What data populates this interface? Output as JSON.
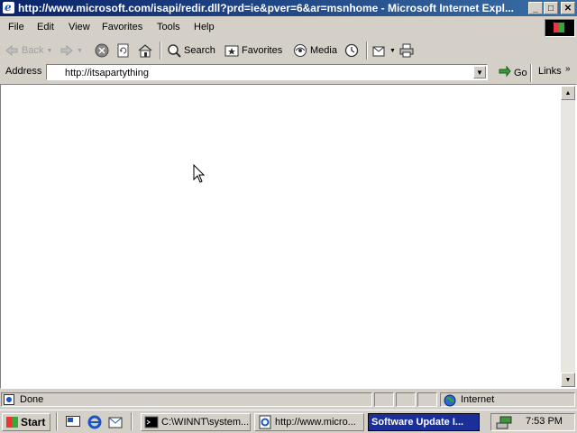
{
  "window": {
    "title": "http://www.microsoft.com/isapi/redir.dll?prd=ie&pver=6&ar=msnhome - Microsoft Internet Expl...",
    "controls": {
      "minimize": "_",
      "maximize": "□",
      "close": "✕"
    }
  },
  "menubar": {
    "items": [
      "File",
      "Edit",
      "View",
      "Favorites",
      "Tools",
      "Help"
    ]
  },
  "toolbar": {
    "back": "Back",
    "search": "Search",
    "favorites": "Favorites",
    "media": "Media"
  },
  "addressbar": {
    "label": "Address",
    "url": "http://itsapartything",
    "go": "Go",
    "links": "Links"
  },
  "statusbar": {
    "status": "Done",
    "zone": "Internet"
  },
  "taskbar": {
    "start": "Start",
    "tasks": [
      {
        "label": "C:\\WINNT\\system...",
        "active": false
      },
      {
        "label": "http://www.micro...",
        "active": false
      },
      {
        "label": "Software Update I...",
        "active": true
      }
    ],
    "clock": "7:53 PM"
  },
  "colors": {
    "titlebar_start": "#0a246a",
    "titlebar_end": "#3a6ea5",
    "active_task": "#1a2f9a",
    "chrome": "#d4d0c8"
  }
}
